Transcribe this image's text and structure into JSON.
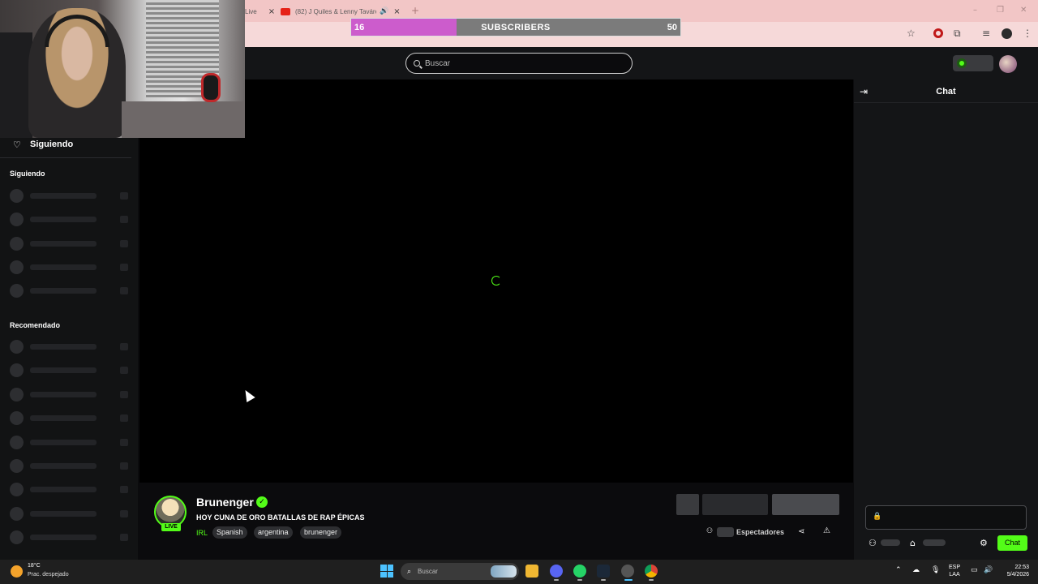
{
  "browser": {
    "tabs": [
      {
        "label": "Live",
        "close": "×"
      },
      {
        "label": "(82) J Quiles & Lenny Tavárez",
        "audio": "🔊",
        "close": "×"
      }
    ],
    "new_tab": "+",
    "window_controls": [
      "–",
      "❐",
      "✕"
    ],
    "toolbar_icons": [
      "star-icon",
      "extension-icon",
      "media-icon",
      "menu-icon"
    ]
  },
  "subscribers_overlay": {
    "current": "16",
    "label": "SUBSCRIBERS",
    "goal": "50",
    "progress": 0.32,
    "fill_color": "#cc5ccc"
  },
  "header": {
    "search_placeholder": "Buscar"
  },
  "sidebar": {
    "following_button": "Siguiendo",
    "following_section": "Siguiendo",
    "following_count": 5,
    "recommended_section": "Recomendado",
    "recommended_count": 9
  },
  "player": {
    "state": "loading",
    "accent_color": "#53fc18"
  },
  "chat": {
    "title": "Chat",
    "send_label": "Chat"
  },
  "stream": {
    "channel": "Brunenger",
    "live_badge": "LIVE",
    "title": "HOY CUNA DE ORO BATALLAS DE RAP ÉPICAS",
    "category": "IRL",
    "tags": [
      "Spanish",
      "argentina",
      "brunenger"
    ],
    "viewers_label": "Espectadores"
  },
  "taskbar": {
    "weather_temp": "18°C",
    "weather_desc": "Prac. despejado",
    "search_placeholder": "Buscar",
    "lang_line1": "ESP",
    "lang_line2": "LAA",
    "time": "22:53",
    "date": "5/4/2026"
  }
}
